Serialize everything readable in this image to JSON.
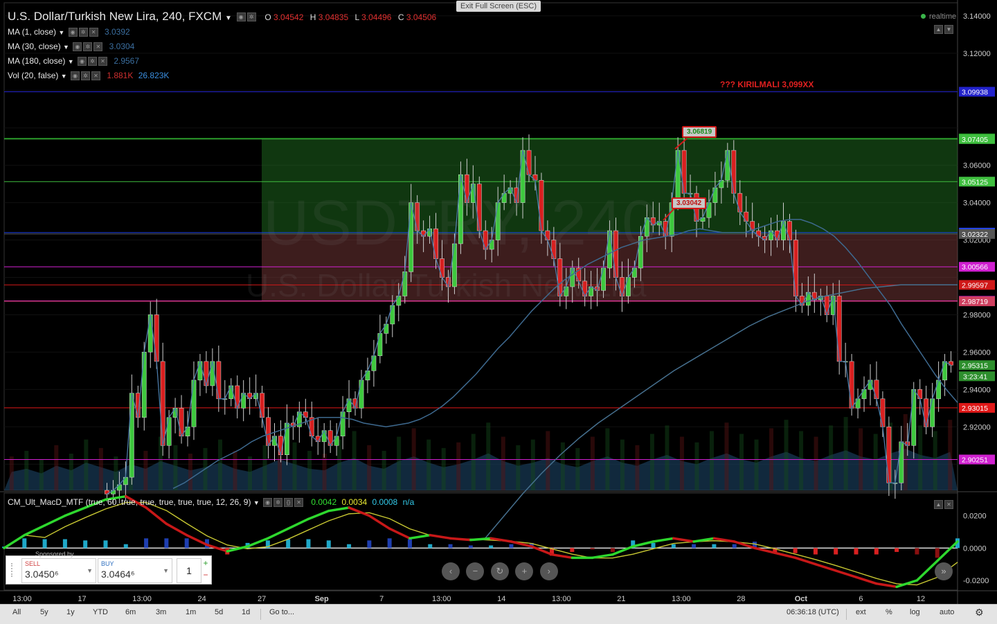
{
  "header": {
    "symbol": "U.S. Dollar/Turkish New Lira, 240, FXCM",
    "ohlc": {
      "o_label": "O",
      "o": "3.04542",
      "h_label": "H",
      "h": "3.04835",
      "l_label": "L",
      "l": "3.04496",
      "c_label": "C",
      "c": "3.04506"
    }
  },
  "indicators": [
    {
      "label": "MA (1, close)",
      "value": "3.0392",
      "color": "#3b6fa0"
    },
    {
      "label": "MA (30, close)",
      "value": "3.0304",
      "color": "#3b6fa0"
    },
    {
      "label": "MA (180, close)",
      "value": "2.9567",
      "color": "#3b6fa0"
    },
    {
      "label": "Vol (20, false)",
      "value": "1.881K",
      "value2": "26.823K",
      "color": "#d03030",
      "color2": "#3b8fe0"
    }
  ],
  "exit_fullscreen": "Exit Full Screen (ESC)",
  "realtime_label": "realtime",
  "annotation_text": "??? KIRILMALI 3,099XX",
  "watermark": {
    "line1": "USDTRY, 240",
    "line2": "U.S. Dollar/Turkish New Lira"
  },
  "price_tags": {
    "high": "3.06819",
    "mid": "3.03042"
  },
  "macd": {
    "title": "CM_Ult_MacD_MTF (true, 60, true, true, true, true, true, 12, 26, 9)",
    "v1": "0.0042",
    "v2": "0.0034",
    "v3": "0.0008",
    "v4": "n/a"
  },
  "trade_panel": {
    "sponsored": "Sponsored by",
    "sell_label": "SELL",
    "sell_price": "3.0450⁶",
    "buy_label": "BUY",
    "buy_price": "3.0464⁶",
    "qty": "1"
  },
  "bottom_bar": {
    "ranges": [
      "All",
      "5y",
      "1y",
      "YTD",
      "6m",
      "3m",
      "1m",
      "5d",
      "1d"
    ],
    "goto": "Go to...",
    "time": "06:36:18 (UTC)",
    "right": [
      "ext",
      "%",
      "log",
      "auto"
    ]
  },
  "chart_data": {
    "type": "candlestick",
    "price_axis": {
      "ylim": [
        2.886,
        3.147
      ],
      "ticks": [
        "3.14000",
        "3.12000",
        "3.10000",
        "3.08000",
        "3.06000",
        "3.04000",
        "3.02000",
        "3.00000",
        "2.98000",
        "2.96000",
        "2.94000",
        "2.92000",
        "2.90000",
        "2.88000"
      ],
      "visible_ticks": [
        "3.14000",
        "3.12000",
        "3.06000",
        "3.04000",
        "3.02000",
        "2.98000",
        "2.96000",
        "2.94000",
        "2.92000"
      ]
    },
    "macd_axis": {
      "ylim": [
        -0.026,
        0.034
      ],
      "ticks": [
        "0.0200",
        "0.0000",
        "-0.0200"
      ]
    },
    "x_ticks": [
      "13:00",
      "17",
      "13:00",
      "24",
      "27",
      "Sep",
      "7",
      "13:00",
      "14",
      "13:00",
      "21",
      "13:00",
      "28",
      "Oct",
      "6",
      "12"
    ],
    "horizontal_lines": [
      {
        "price": 3.09938,
        "label": "3.09938",
        "color": "#2222cc"
      },
      {
        "price": 3.07441,
        "label": "3.07441",
        "color": "#1f8f1f"
      },
      {
        "price": 3.07405,
        "label": "3.07405",
        "color": "#3fbf3f"
      },
      {
        "price": 3.05125,
        "label": "3.05125",
        "color": "#3fbf3f"
      },
      {
        "price": 3.02396,
        "label": "3.02396",
        "color": "#2244ee"
      },
      {
        "price": 3.02322,
        "label": "3.02322",
        "color": "#555555"
      },
      {
        "price": 3.00566,
        "label": "3.00566",
        "color": "#d020d0"
      },
      {
        "price": 2.99597,
        "label": "2.99597",
        "color": "#d01818"
      },
      {
        "price": 2.98743,
        "label": "2.98743",
        "color": "#d020d0"
      },
      {
        "price": 2.98719,
        "label": "2.98719",
        "color": "#d04060"
      },
      {
        "price": 2.93015,
        "label": "2.93015",
        "color": "#e01818"
      },
      {
        "price": 2.90251,
        "label": "2.90251",
        "color": "#d020d0"
      }
    ],
    "last_price": {
      "label": "2.95315",
      "countdown": "3:23:41"
    },
    "zones": [
      {
        "from": 3.02322,
        "to": 3.07405,
        "color": "#1f6e1f"
      },
      {
        "from": 2.98719,
        "to": 3.02322,
        "color": "#7a3a3a"
      }
    ],
    "candles_close": [
      2.884,
      2.886,
      2.889,
      2.893,
      2.938,
      2.925,
      2.96,
      2.98,
      2.955,
      2.91,
      2.925,
      2.93,
      2.915,
      2.92,
      2.945,
      2.955,
      2.942,
      2.955,
      2.935,
      2.935,
      2.942,
      2.93,
      2.938,
      2.935,
      2.938,
      2.925,
      2.91,
      2.915,
      2.905,
      2.922,
      2.92,
      2.928,
      2.925,
      2.915,
      2.912,
      2.918,
      2.91,
      2.915,
      2.928,
      2.935,
      2.93,
      2.945,
      2.95,
      2.958,
      2.97,
      2.975,
      2.985,
      2.99,
      3.003,
      3.04,
      3.025,
      3.022,
      3.026,
      3.01,
      3.0,
      2.995,
      3.018,
      3.055,
      3.04,
      3.05,
      3.025,
      3.015,
      3.02,
      3.04,
      3.045,
      3.048,
      3.04,
      3.068,
      3.055,
      3.052,
      3.025,
      3.02,
      3.01,
      2.99,
      2.995,
      3.005,
      2.998,
      2.99,
      2.995,
      2.993,
      3.005,
      3.025,
      3.0,
      2.99,
      3.0,
      3.005,
      3.022,
      3.032,
      3.028,
      3.03,
      3.022,
      3.04,
      3.068,
      3.045,
      3.045,
      3.03,
      3.032,
      3.04,
      3.048,
      3.052,
      3.068,
      3.045,
      3.035,
      3.03,
      3.025,
      3.022,
      3.02,
      3.025,
      3.02,
      3.03,
      3.02,
      2.99,
      2.985,
      2.992,
      2.988,
      2.99,
      2.98,
      2.99,
      2.955,
      2.955,
      2.93,
      2.935,
      2.94,
      2.945,
      2.935,
      2.92,
      2.89,
      2.89,
      2.912,
      2.91,
      2.94,
      2.935,
      2.92,
      2.935,
      2.945,
      2.955,
      2.953
    ],
    "ma30": [
      2.887,
      2.89,
      2.894,
      2.898,
      2.902,
      2.905,
      2.908,
      2.912,
      2.915,
      2.917,
      2.919,
      2.921,
      2.923,
      2.925,
      2.925,
      2.925,
      2.924,
      2.922,
      2.921,
      2.92,
      2.921,
      2.922,
      2.924,
      2.927,
      2.931,
      2.936,
      2.942,
      2.948,
      2.955,
      2.962,
      2.968,
      2.975,
      2.982,
      2.988,
      2.994,
      2.999,
      3.003,
      3.007,
      3.01,
      3.013,
      3.016,
      3.018,
      3.02,
      3.021,
      3.022,
      3.023,
      3.025,
      3.026,
      3.025,
      3.024,
      3.024,
      3.024,
      3.026,
      3.028,
      3.03,
      3.031,
      3.031,
      3.029,
      3.026,
      3.022,
      3.016,
      3.009,
      3.001,
      2.993,
      2.985,
      2.975,
      2.966,
      2.957,
      2.948,
      2.94,
      2.933
    ],
    "ma180": [
      2.86,
      2.872,
      2.884,
      2.895,
      2.905,
      2.914,
      2.922,
      2.929,
      2.936,
      2.943,
      2.95,
      2.956,
      2.962,
      2.968,
      2.974,
      2.979,
      2.983,
      2.987,
      2.99,
      2.992,
      2.994,
      2.995,
      2.996,
      2.996,
      2.996,
      2.996
    ],
    "macd_line": [
      0.0,
      0.008,
      0.014,
      0.02,
      0.025,
      0.03,
      0.032,
      0.025,
      0.015,
      0.008,
      0.002,
      -0.002,
      0.001,
      0.006,
      0.012,
      0.018,
      0.023,
      0.025,
      0.02,
      0.012,
      0.006,
      0.008,
      0.006,
      0.005,
      0.006,
      0.004,
      0.001,
      -0.004,
      -0.006,
      -0.006,
      -0.004,
      0.001,
      0.004,
      0.006,
      0.004,
      0.006,
      0.004,
      0.0,
      -0.003,
      -0.006,
      -0.01,
      -0.014,
      -0.018,
      -0.022,
      -0.024,
      -0.02,
      -0.008,
      0.004
    ],
    "volume": [
      12,
      14,
      11,
      16,
      13,
      18,
      15,
      12,
      17,
      14,
      19,
      16,
      13,
      15,
      18,
      14,
      12,
      16,
      20,
      17,
      14,
      13,
      18,
      21,
      16,
      14,
      19,
      22,
      18,
      15,
      17,
      20,
      24,
      19,
      16,
      18,
      21,
      17,
      15,
      19,
      22,
      18,
      16,
      20,
      23,
      19,
      17,
      21,
      24,
      20,
      18,
      22,
      25,
      21,
      19,
      23,
      26,
      22,
      20,
      24,
      27,
      23,
      21,
      25
    ]
  }
}
